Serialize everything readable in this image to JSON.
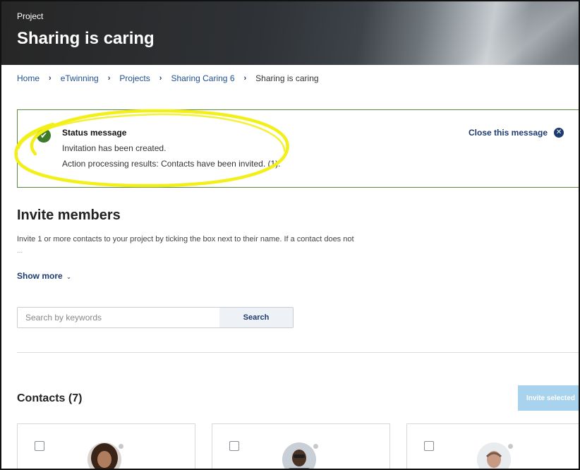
{
  "header": {
    "kicker": "Project",
    "title": "Sharing is caring"
  },
  "breadcrumb": {
    "items": [
      "Home",
      "eTwinning",
      "Projects",
      "Sharing Caring 6"
    ],
    "current": "Sharing is caring",
    "separator": "›"
  },
  "status": {
    "title": "Status message",
    "line1": "Invitation has been created.",
    "line2": "Action processing results: Contacts have been invited. (1).",
    "close_label": "Close this message",
    "check_icon": "check-icon",
    "close_icon": "close-icon",
    "success_color": "#3d7a2a",
    "highlight_color": "#f3ef19"
  },
  "invite": {
    "title": "Invite members",
    "description": "Invite 1 or more contacts to your project by ticking the box next to their name. If a contact does not",
    "ellipsis": "...",
    "show_more": "Show more"
  },
  "search": {
    "placeholder": "Search by keywords",
    "button_label": "Search"
  },
  "contacts": {
    "title": "Contacts (7)",
    "invite_selected_label": "Invite selected"
  }
}
